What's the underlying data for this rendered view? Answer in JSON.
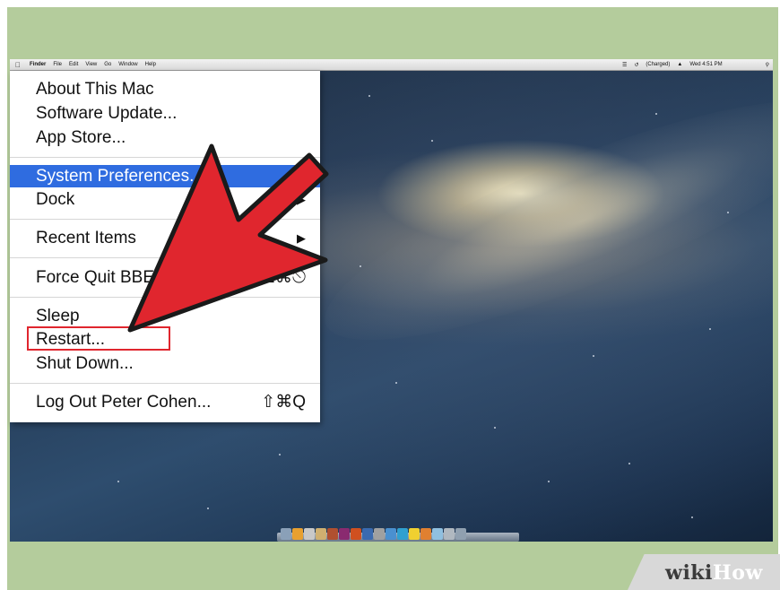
{
  "menubar": {
    "apple_icon": "apple-icon",
    "app_name": "Finder",
    "items": [
      "File",
      "Edit",
      "View",
      "Go",
      "Window",
      "Help"
    ],
    "battery_status": "(Charged)",
    "clock": "Wed 4:51 PM",
    "status_icons": [
      "wifi-icon",
      "time-machine-icon",
      "volume-icon",
      "spotlight-icon"
    ]
  },
  "apple_menu": {
    "about": "About This Mac",
    "software_update": "Software Update...",
    "app_store": "App Store...",
    "system_preferences": "System Preferences...",
    "dock": "Dock",
    "recent_items": "Recent Items",
    "force_quit": "Force Quit BBEdit",
    "force_quit_shortcut": "⌥⌘⎋",
    "sleep": "Sleep",
    "restart": "Restart...",
    "shut_down": "Shut Down...",
    "log_out": "Log Out Peter Cohen...",
    "log_out_shortcut": "⇧⌘Q"
  },
  "annotation": {
    "arrow_color": "#e0262e",
    "highlight_color": "#e0262e"
  },
  "watermark": {
    "wiki": "wiki",
    "how": "How"
  }
}
